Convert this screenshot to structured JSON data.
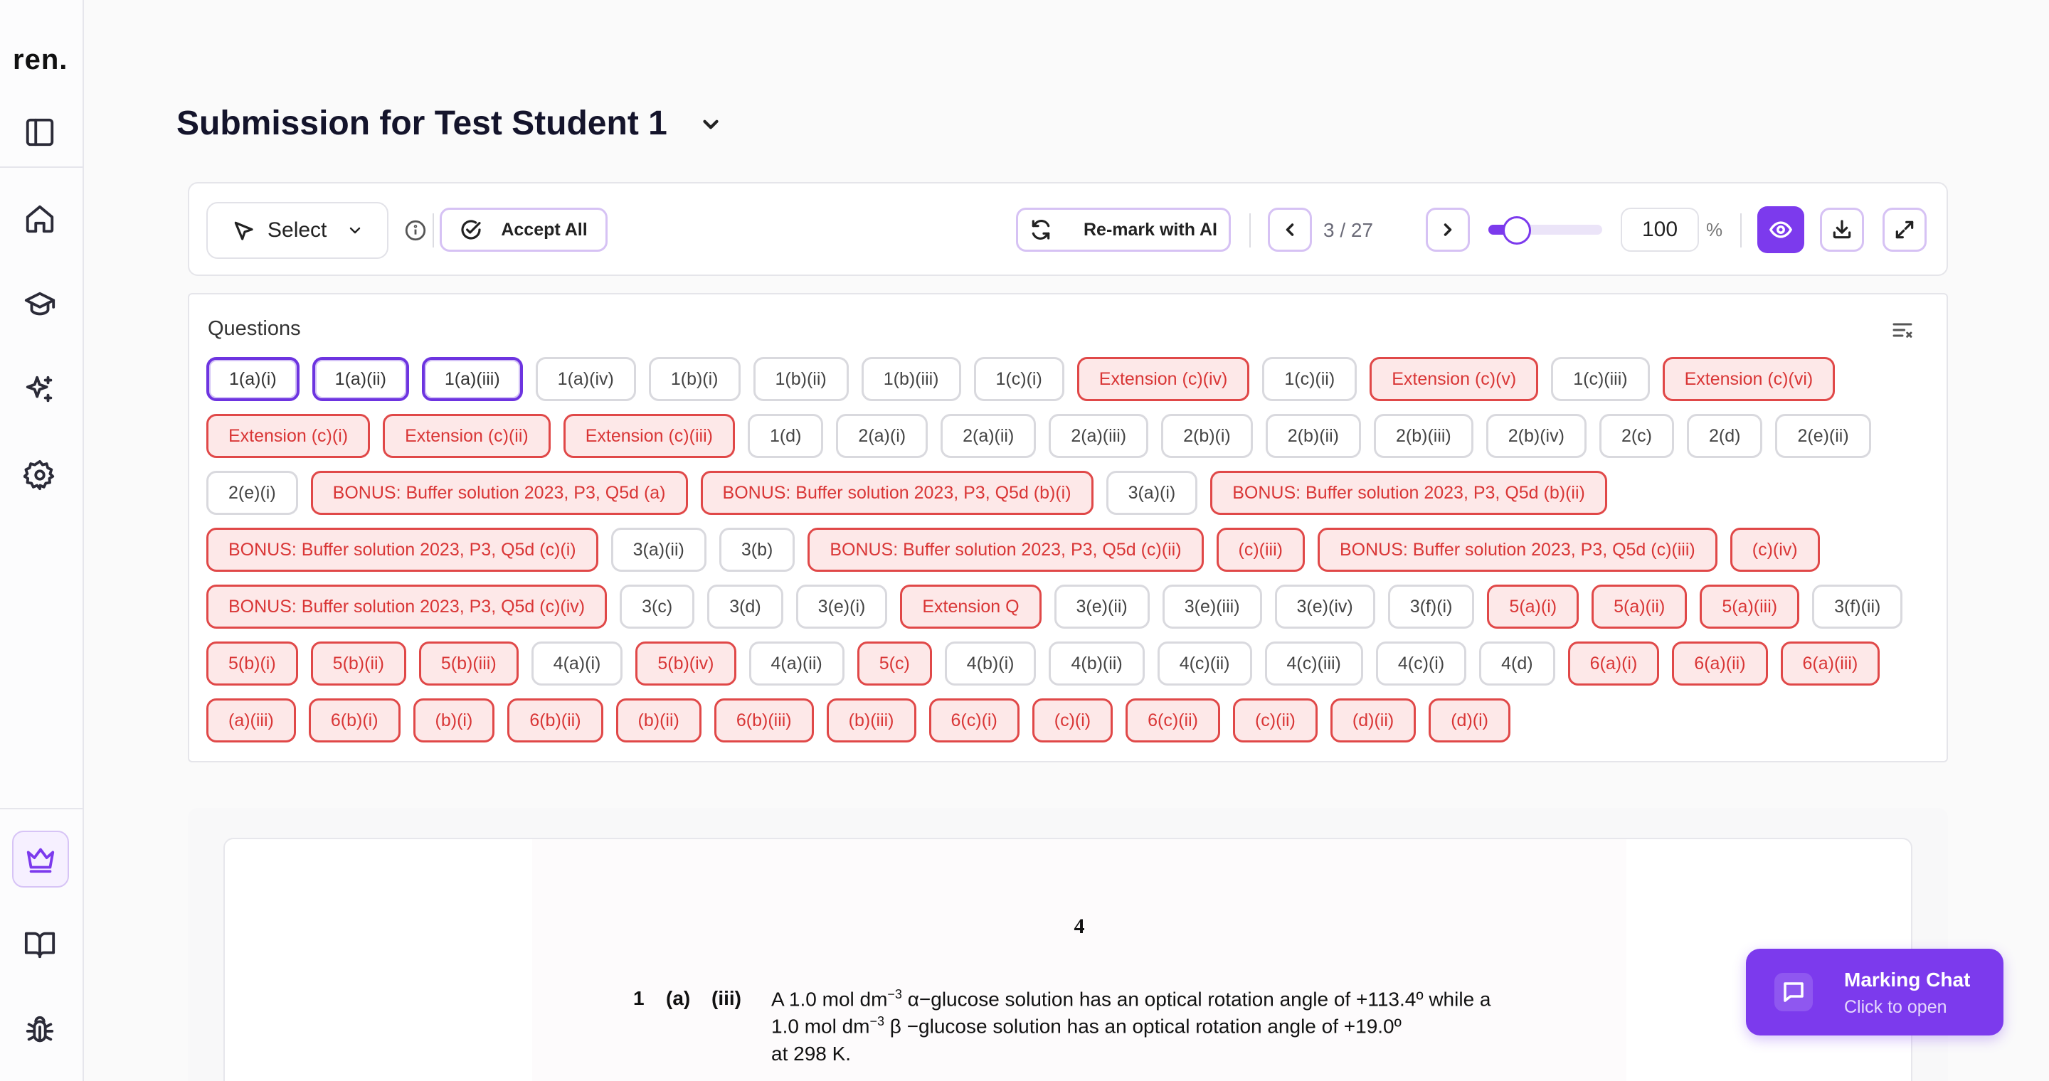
{
  "app": {
    "logo": "ren."
  },
  "header": {
    "title": "Submission for Test Student 1"
  },
  "toolbar": {
    "select_label": "Select",
    "accept_all_label": "Accept All",
    "remark_label": "Re-mark with AI",
    "page_indicator": "3 / 27",
    "zoom_value": "100",
    "zoom_unit": "%",
    "zoom_level_fraction": 0.25
  },
  "questions": {
    "title": "Questions",
    "chips": [
      {
        "label": "1(a)(i)",
        "state": "active"
      },
      {
        "label": "1(a)(ii)",
        "state": "active"
      },
      {
        "label": "1(a)(iii)",
        "state": "active"
      },
      {
        "label": "1(a)(iv)",
        "state": "normal"
      },
      {
        "label": "1(b)(i)",
        "state": "normal"
      },
      {
        "label": "1(b)(ii)",
        "state": "normal"
      },
      {
        "label": "1(b)(iii)",
        "state": "normal"
      },
      {
        "label": "1(c)(i)",
        "state": "normal"
      },
      {
        "label": "Extension (c)(iv)",
        "state": "red"
      },
      {
        "label": "1(c)(ii)",
        "state": "normal"
      },
      {
        "label": "Extension (c)(v)",
        "state": "red"
      },
      {
        "label": "1(c)(iii)",
        "state": "normal"
      },
      {
        "label": "Extension (c)(vi)",
        "state": "red"
      },
      {
        "label": "Extension (c)(i)",
        "state": "red"
      },
      {
        "label": "Extension (c)(ii)",
        "state": "red"
      },
      {
        "label": "Extension (c)(iii)",
        "state": "red"
      },
      {
        "label": "1(d)",
        "state": "normal"
      },
      {
        "label": "2(a)(i)",
        "state": "normal"
      },
      {
        "label": "2(a)(ii)",
        "state": "normal"
      },
      {
        "label": "2(a)(iii)",
        "state": "normal"
      },
      {
        "label": "2(b)(i)",
        "state": "normal"
      },
      {
        "label": "2(b)(ii)",
        "state": "normal"
      },
      {
        "label": "2(b)(iii)",
        "state": "normal"
      },
      {
        "label": "2(b)(iv)",
        "state": "normal"
      },
      {
        "label": "2(c)",
        "state": "normal"
      },
      {
        "label": "2(d)",
        "state": "normal"
      },
      {
        "label": "2(e)(ii)",
        "state": "normal"
      },
      {
        "label": "2(e)(i)",
        "state": "normal"
      },
      {
        "label": "BONUS: Buffer solution 2023, P3, Q5d (a)",
        "state": "red"
      },
      {
        "label": "BONUS: Buffer solution 2023, P3, Q5d (b)(i)",
        "state": "red"
      },
      {
        "label": "3(a)(i)",
        "state": "normal"
      },
      {
        "label": "BONUS: Buffer solution 2023, P3, Q5d (b)(ii)",
        "state": "red"
      },
      {
        "label": "BONUS: Buffer solution 2023, P3, Q5d (c)(i)",
        "state": "red"
      },
      {
        "label": "3(a)(ii)",
        "state": "normal"
      },
      {
        "label": "3(b)",
        "state": "normal"
      },
      {
        "label": "BONUS: Buffer solution 2023, P3, Q5d (c)(ii)",
        "state": "red"
      },
      {
        "label": "(c)(iii)",
        "state": "red"
      },
      {
        "label": "BONUS: Buffer solution 2023, P3, Q5d (c)(iii)",
        "state": "red"
      },
      {
        "label": "(c)(iv)",
        "state": "red"
      },
      {
        "label": "BONUS: Buffer solution 2023, P3, Q5d (c)(iv)",
        "state": "red"
      },
      {
        "label": "3(c)",
        "state": "normal"
      },
      {
        "label": "3(d)",
        "state": "normal"
      },
      {
        "label": "3(e)(i)",
        "state": "normal"
      },
      {
        "label": "Extension Q",
        "state": "red"
      },
      {
        "label": "3(e)(ii)",
        "state": "normal"
      },
      {
        "label": "3(e)(iii)",
        "state": "normal"
      },
      {
        "label": "3(e)(iv)",
        "state": "normal"
      },
      {
        "label": "3(f)(i)",
        "state": "normal"
      },
      {
        "label": "5(a)(i)",
        "state": "red"
      },
      {
        "label": "5(a)(ii)",
        "state": "red"
      },
      {
        "label": "5(a)(iii)",
        "state": "red"
      },
      {
        "label": "3(f)(ii)",
        "state": "normal"
      },
      {
        "label": "5(b)(i)",
        "state": "red"
      },
      {
        "label": "5(b)(ii)",
        "state": "red"
      },
      {
        "label": "5(b)(iii)",
        "state": "red"
      },
      {
        "label": "4(a)(i)",
        "state": "normal"
      },
      {
        "label": "5(b)(iv)",
        "state": "red"
      },
      {
        "label": "4(a)(ii)",
        "state": "normal"
      },
      {
        "label": "5(c)",
        "state": "red"
      },
      {
        "label": "4(b)(i)",
        "state": "normal"
      },
      {
        "label": "4(b)(ii)",
        "state": "normal"
      },
      {
        "label": "4(c)(ii)",
        "state": "normal"
      },
      {
        "label": "4(c)(iii)",
        "state": "normal"
      },
      {
        "label": "4(c)(i)",
        "state": "normal"
      },
      {
        "label": "4(d)",
        "state": "normal"
      },
      {
        "label": "6(a)(i)",
        "state": "red"
      },
      {
        "label": "6(a)(ii)",
        "state": "red"
      },
      {
        "label": "6(a)(iii)",
        "state": "red"
      },
      {
        "label": "(a)(iii)",
        "state": "red"
      },
      {
        "label": "6(b)(i)",
        "state": "red"
      },
      {
        "label": "(b)(i)",
        "state": "red"
      },
      {
        "label": "6(b)(ii)",
        "state": "red"
      },
      {
        "label": "(b)(ii)",
        "state": "red"
      },
      {
        "label": "6(b)(iii)",
        "state": "red"
      },
      {
        "label": "(b)(iii)",
        "state": "red"
      },
      {
        "label": "6(c)(i)",
        "state": "red"
      },
      {
        "label": "(c)(i)",
        "state": "red"
      },
      {
        "label": "6(c)(ii)",
        "state": "red"
      },
      {
        "label": "(c)(ii)",
        "state": "red"
      },
      {
        "label": "(d)(ii)",
        "state": "red"
      },
      {
        "label": "(d)(i)",
        "state": "red"
      }
    ]
  },
  "document": {
    "page_number": "4",
    "q_num": "1",
    "q_part": "(a)",
    "q_sub": "(iii)",
    "line1_a": "A 1.0 mol dm",
    "line1_exp": "−3",
    "line1_b": " α−glucose solution has an optical rotation angle of +113.4º while a",
    "line2_a": "1.0  mol  dm",
    "line2_exp": "−3",
    "line2_b": "  β  −glucose  solution  has  an  optical  rotation  angle  of  +19.0º",
    "line3": "at 298 K."
  },
  "chat": {
    "title": "Marking Chat",
    "subtitle": "Click to open"
  },
  "colors": {
    "accent": "#7c3aed",
    "error": "#e04848",
    "error_bg": "#fde8e8"
  }
}
